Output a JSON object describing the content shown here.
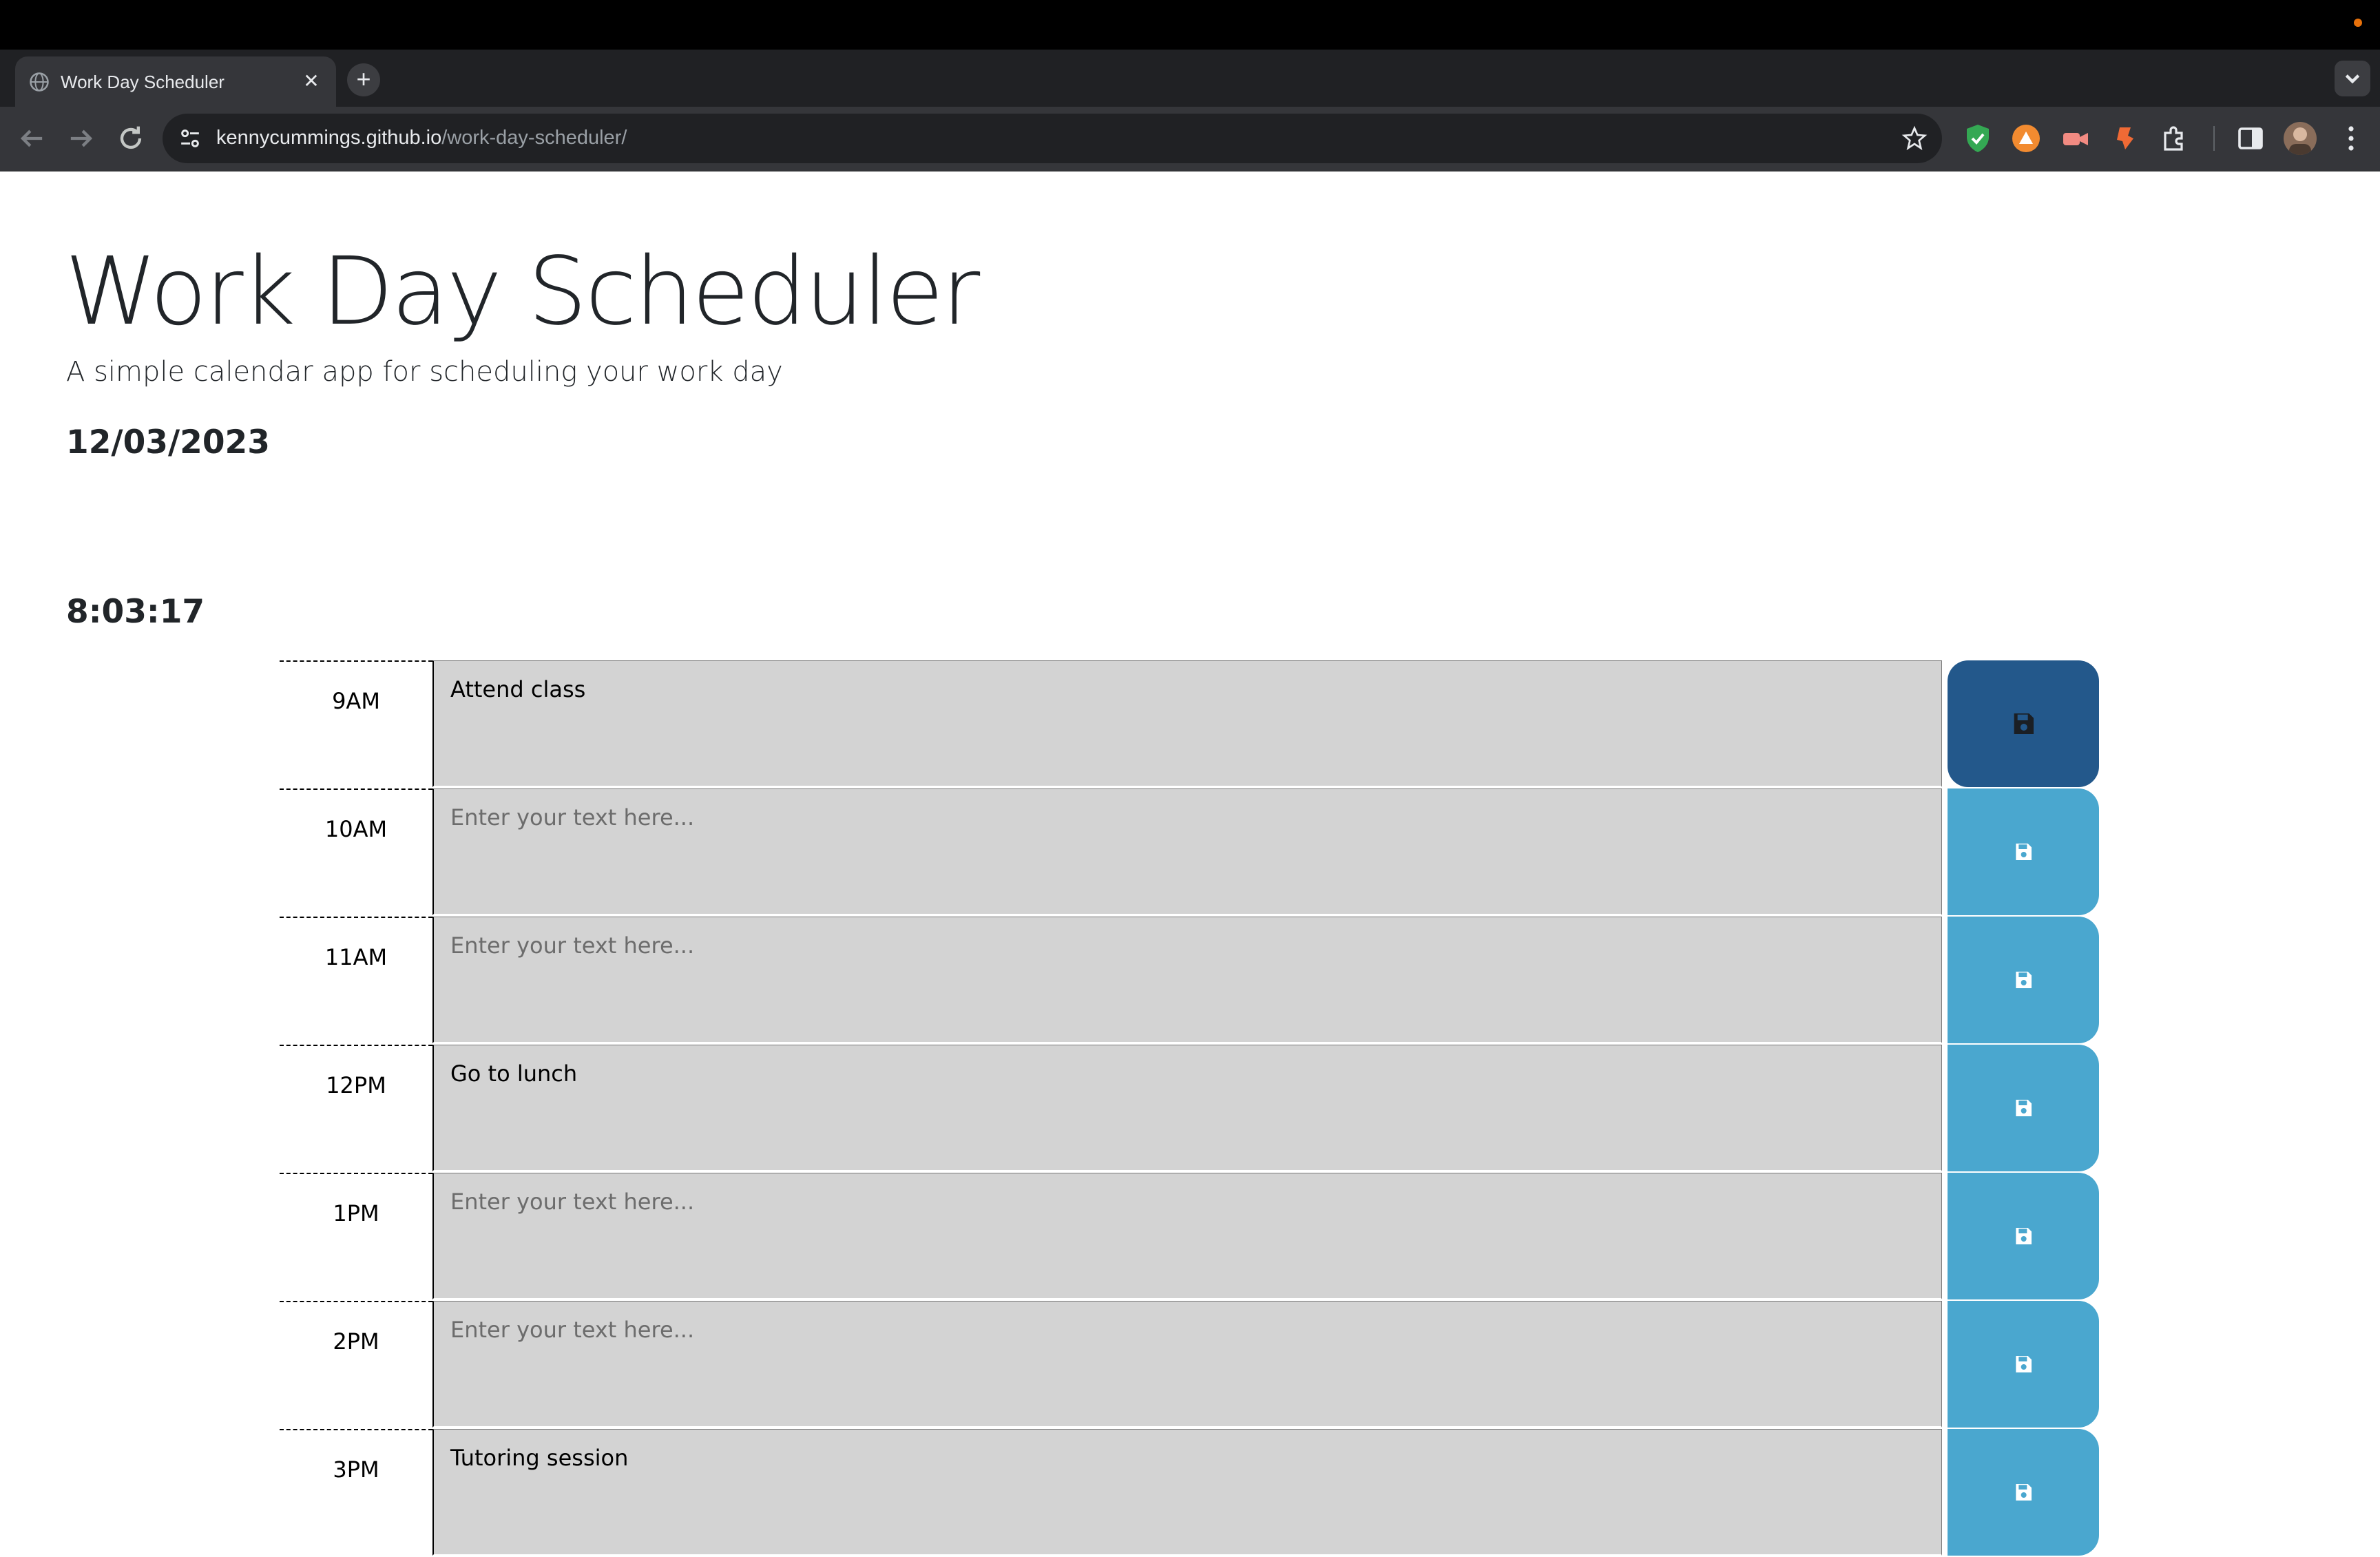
{
  "browser": {
    "tab_title": "Work Day Scheduler",
    "url_host": "kennycummings.github.io",
    "url_path": "/work-day-scheduler/"
  },
  "app": {
    "title": "Work Day Scheduler",
    "subtitle": "A simple calendar app for scheduling your work day",
    "date": "12/03/2023",
    "time": "8:03:17"
  },
  "placeholder": "Enter your text here...",
  "rows": [
    {
      "hour": "9AM",
      "text": "Attend class"
    },
    {
      "hour": "10AM",
      "text": ""
    },
    {
      "hour": "11AM",
      "text": ""
    },
    {
      "hour": "12PM",
      "text": "Go to lunch"
    },
    {
      "hour": "1PM",
      "text": ""
    },
    {
      "hour": "2PM",
      "text": ""
    },
    {
      "hour": "3PM",
      "text": "Tutoring session"
    }
  ],
  "colors": {
    "save_active": "#23588b",
    "save_default": "#4aa7cf",
    "row_background": "#d3d3d3"
  },
  "icons": {
    "save": "floppy-disk-icon"
  }
}
